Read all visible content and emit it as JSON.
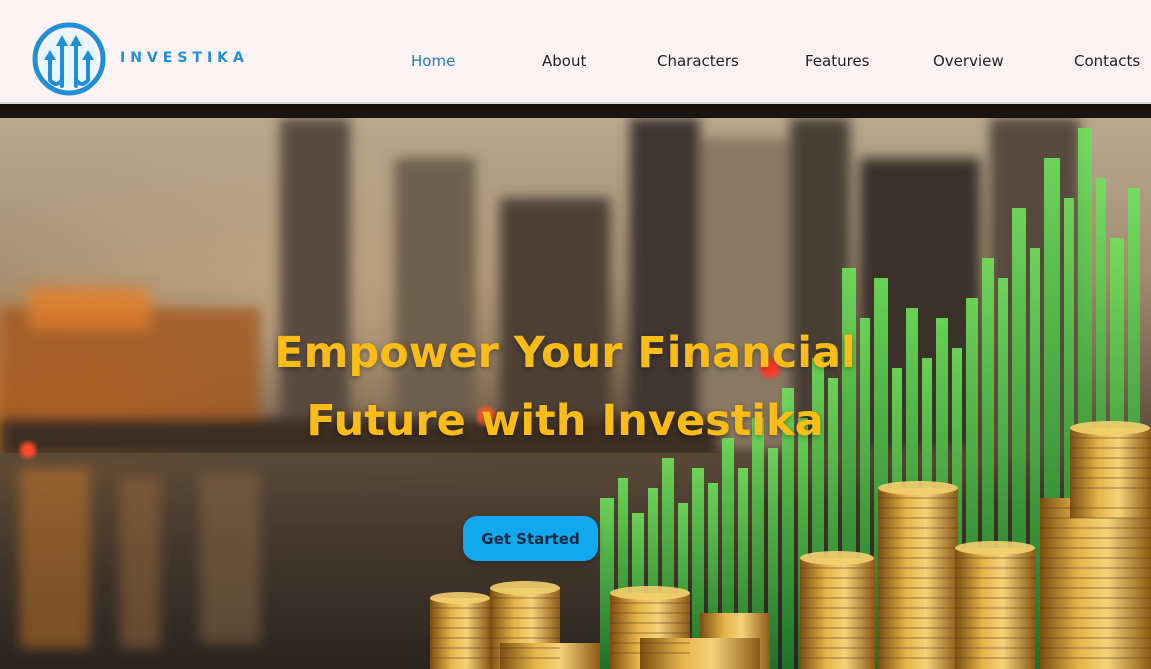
{
  "brand": {
    "name": "INVESTIKA",
    "primary_color": "#1f8fd9"
  },
  "nav": {
    "items": [
      {
        "label": "Home",
        "active": true
      },
      {
        "label": "About",
        "active": false
      },
      {
        "label": "Characters",
        "active": false
      },
      {
        "label": "Features",
        "active": false
      },
      {
        "label": "Overview",
        "active": false
      },
      {
        "label": "Contacts",
        "active": false
      }
    ],
    "active_color": "#1f7fc4"
  },
  "hero": {
    "headline_line1": "Empower Your Financial",
    "headline_line2": "Future with Investika",
    "headline_color": "#fbbd15",
    "cta_label": "Get Started",
    "cta_color": "#12a8ee"
  }
}
